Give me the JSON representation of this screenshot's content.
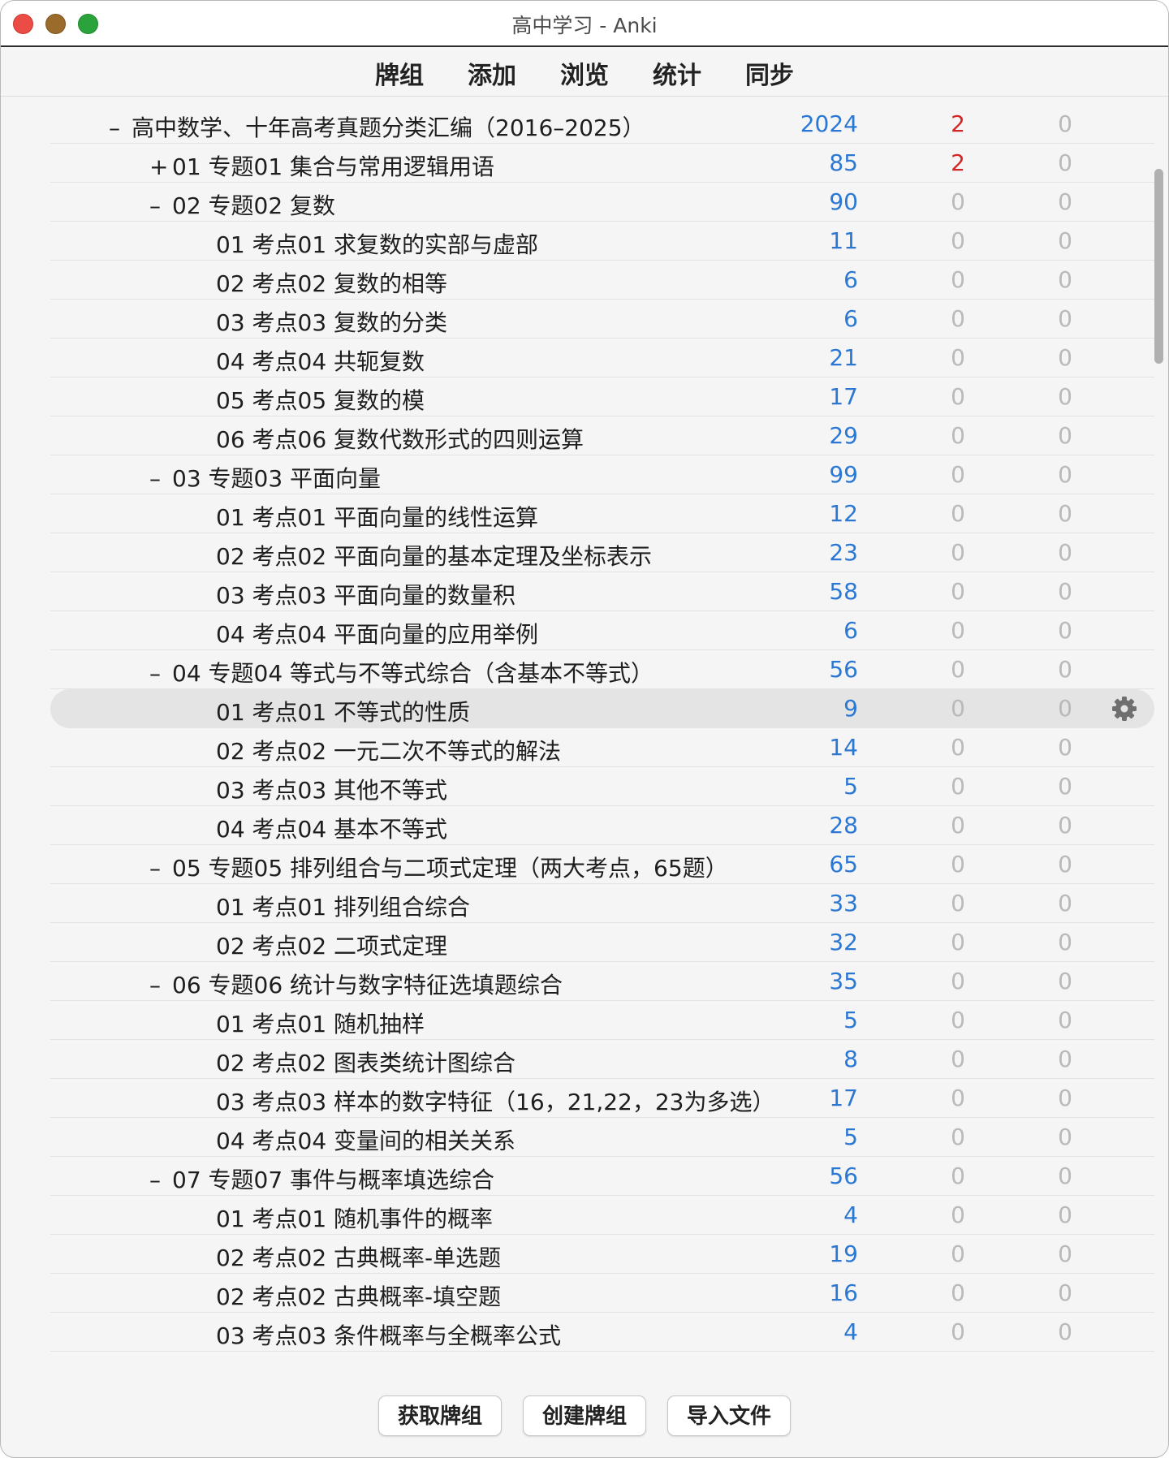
{
  "window": {
    "title": "高中学习 - Anki"
  },
  "toolbar": {
    "items": [
      "牌组",
      "添加",
      "浏览",
      "统计",
      "同步"
    ]
  },
  "colors": {
    "new": "#2a78d4",
    "learn_red": "#d42424",
    "zero": "#b9b9b9"
  },
  "decks": [
    {
      "level": 0,
      "toggle": "–",
      "name": "高中数学、十年高考真题分类汇编（2016–2025）",
      "new": "2024",
      "learn": "2",
      "due": "0",
      "learn_red": true
    },
    {
      "level": 1,
      "toggle": "+",
      "name": "01 专题01 集合与常用逻辑用语",
      "new": "85",
      "learn": "2",
      "due": "0",
      "learn_red": true
    },
    {
      "level": 1,
      "toggle": "–",
      "name": "02 专题02 复数",
      "new": "90",
      "learn": "0",
      "due": "0"
    },
    {
      "level": 2,
      "toggle": "",
      "name": "01 考点01 求复数的实部与虚部",
      "new": "11",
      "learn": "0",
      "due": "0"
    },
    {
      "level": 2,
      "toggle": "",
      "name": "02 考点02 复数的相等",
      "new": "6",
      "learn": "0",
      "due": "0"
    },
    {
      "level": 2,
      "toggle": "",
      "name": "03 考点03 复数的分类",
      "new": "6",
      "learn": "0",
      "due": "0"
    },
    {
      "level": 2,
      "toggle": "",
      "name": "04 考点04 共轭复数",
      "new": "21",
      "learn": "0",
      "due": "0"
    },
    {
      "level": 2,
      "toggle": "",
      "name": "05 考点05 复数的模",
      "new": "17",
      "learn": "0",
      "due": "0"
    },
    {
      "level": 2,
      "toggle": "",
      "name": "06 考点06 复数代数形式的四则运算",
      "new": "29",
      "learn": "0",
      "due": "0"
    },
    {
      "level": 1,
      "toggle": "–",
      "name": "03 专题03 平面向量",
      "new": "99",
      "learn": "0",
      "due": "0"
    },
    {
      "level": 2,
      "toggle": "",
      "name": "01 考点01 平面向量的线性运算",
      "new": "12",
      "learn": "0",
      "due": "0"
    },
    {
      "level": 2,
      "toggle": "",
      "name": "02 考点02 平面向量的基本定理及坐标表示",
      "new": "23",
      "learn": "0",
      "due": "0"
    },
    {
      "level": 2,
      "toggle": "",
      "name": "03 考点03 平面向量的数量积",
      "new": "58",
      "learn": "0",
      "due": "0"
    },
    {
      "level": 2,
      "toggle": "",
      "name": "04 考点04 平面向量的应用举例",
      "new": "6",
      "learn": "0",
      "due": "0"
    },
    {
      "level": 1,
      "toggle": "–",
      "name": "04 专题04 等式与不等式综合（含基本不等式）",
      "new": "56",
      "learn": "0",
      "due": "0"
    },
    {
      "level": 2,
      "toggle": "",
      "name": "01 考点01 不等式的性质",
      "new": "9",
      "learn": "0",
      "due": "0",
      "selected": true
    },
    {
      "level": 2,
      "toggle": "",
      "name": "02 考点02 一元二次不等式的解法",
      "new": "14",
      "learn": "0",
      "due": "0"
    },
    {
      "level": 2,
      "toggle": "",
      "name": "03 考点03 其他不等式",
      "new": "5",
      "learn": "0",
      "due": "0"
    },
    {
      "level": 2,
      "toggle": "",
      "name": "04 考点04 基本不等式",
      "new": "28",
      "learn": "0",
      "due": "0"
    },
    {
      "level": 1,
      "toggle": "–",
      "name": "05 专题05 排列组合与二项式定理（两大考点，65题）",
      "new": "65",
      "learn": "0",
      "due": "0"
    },
    {
      "level": 2,
      "toggle": "",
      "name": "01 考点01 排列组合综合",
      "new": "33",
      "learn": "0",
      "due": "0"
    },
    {
      "level": 2,
      "toggle": "",
      "name": "02 考点02 二项式定理",
      "new": "32",
      "learn": "0",
      "due": "0"
    },
    {
      "level": 1,
      "toggle": "–",
      "name": "06 专题06 统计与数字特征选填题综合",
      "new": "35",
      "learn": "0",
      "due": "0"
    },
    {
      "level": 2,
      "toggle": "",
      "name": "01 考点01 随机抽样",
      "new": "5",
      "learn": "0",
      "due": "0"
    },
    {
      "level": 2,
      "toggle": "",
      "name": "02 考点02 图表类统计图综合",
      "new": "8",
      "learn": "0",
      "due": "0"
    },
    {
      "level": 2,
      "toggle": "",
      "name": "03 考点03 样本的数字特征（16，21,22，23为多选）",
      "new": "17",
      "learn": "0",
      "due": "0"
    },
    {
      "level": 2,
      "toggle": "",
      "name": "04 考点04 变量间的相关关系",
      "new": "5",
      "learn": "0",
      "due": "0"
    },
    {
      "level": 1,
      "toggle": "–",
      "name": "07 专题07 事件与概率填选综合",
      "new": "56",
      "learn": "0",
      "due": "0"
    },
    {
      "level": 2,
      "toggle": "",
      "name": "01 考点01 随机事件的概率",
      "new": "4",
      "learn": "0",
      "due": "0"
    },
    {
      "level": 2,
      "toggle": "",
      "name": "02 考点02 古典概率-单选题",
      "new": "19",
      "learn": "0",
      "due": "0"
    },
    {
      "level": 2,
      "toggle": "",
      "name": "02 考点02 古典概率-填空题",
      "new": "16",
      "learn": "0",
      "due": "0"
    },
    {
      "level": 2,
      "toggle": "",
      "name": "03 考点03 条件概率与全概率公式",
      "new": "4",
      "learn": "0",
      "due": "0"
    }
  ],
  "bottom": {
    "buttons": [
      "获取牌组",
      "创建牌组",
      "导入文件"
    ]
  },
  "icons": {
    "gear": "gear-icon",
    "close": "close-icon",
    "minimize": "minimize-icon",
    "maximize": "maximize-icon"
  }
}
